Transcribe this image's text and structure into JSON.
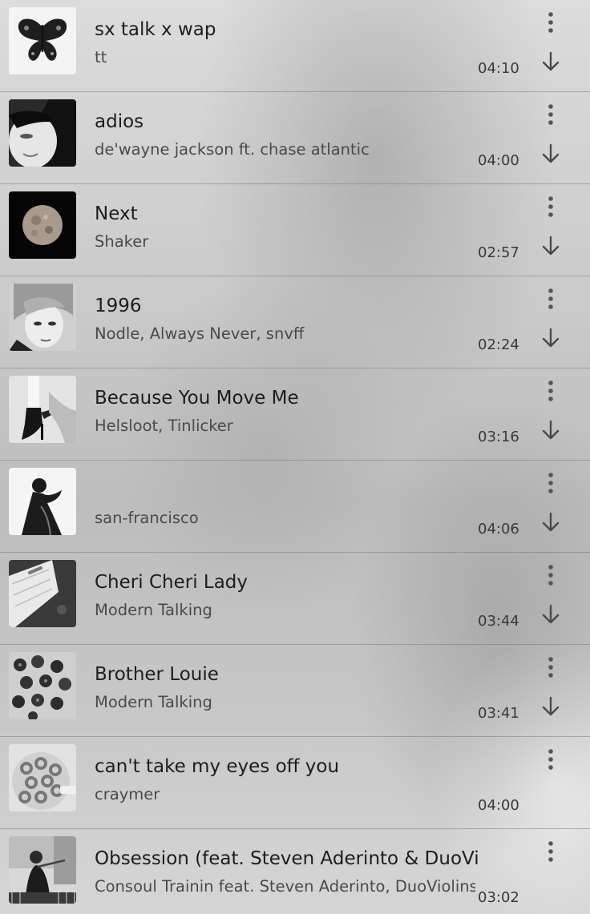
{
  "tracks": [
    {
      "title": "sx talk x wap",
      "artist": "tt",
      "duration": "04:10",
      "art": "butterfly-art"
    },
    {
      "title": "adios",
      "artist": "de'wayne jackson ft. chase atlantic",
      "duration": "04:00",
      "art": "portrait-face-art"
    },
    {
      "title": "Next",
      "artist": "Shaker",
      "duration": "02:57",
      "art": "moon-art"
    },
    {
      "title": "1996",
      "artist": "Nodle, Always Never, snvff",
      "duration": "02:24",
      "art": "portrait-hair-art"
    },
    {
      "title": "Because You Move Me",
      "artist": "Helsloot, Tinlicker",
      "duration": "03:16",
      "art": "heels-art"
    },
    {
      "title": "",
      "artist": "san-francisco",
      "duration": "04:06",
      "art": "silhouette-art"
    },
    {
      "title": "Cheri Cheri Lady",
      "artist": "Modern Talking",
      "duration": "03:44",
      "art": "book-art"
    },
    {
      "title": "Brother Louie",
      "artist": "Modern Talking",
      "duration": "03:41",
      "art": "berries-art"
    },
    {
      "title": "can't take my eyes off you",
      "artist": "craymer",
      "duration": "04:00",
      "art": "cereal-art"
    },
    {
      "title": "Obsession (feat. Steven Aderinto & DuoVio..",
      "artist": "Consoul Trainin feat. Steven Aderinto, DuoViolins",
      "duration": "03:02",
      "art": "violinist-art"
    }
  ],
  "icons": {
    "more": "more-vert-icon",
    "download": "download-arrow-icon"
  }
}
